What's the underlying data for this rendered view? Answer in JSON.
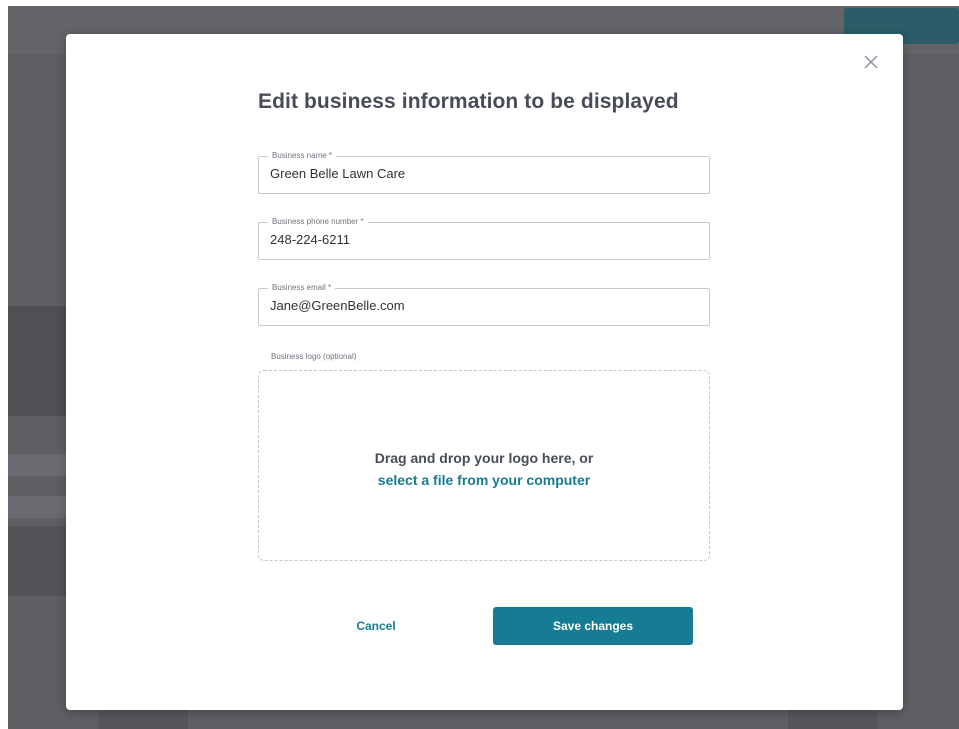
{
  "modal": {
    "title": "Edit business information to be displayed",
    "close_icon": "close-icon",
    "fields": {
      "business_name": {
        "label": "Business name *",
        "value": "Green Belle Lawn Care"
      },
      "business_phone": {
        "label": "Business phone number *",
        "value": "248-224-6211"
      },
      "business_email": {
        "label": "Business email *",
        "value": "Jane@GreenBelle.com"
      }
    },
    "logo": {
      "label": "Business logo (optional)",
      "drop_text": "Drag and drop your logo here, or",
      "select_link": "select a file from your computer"
    },
    "actions": {
      "cancel_label": "Cancel",
      "save_label": "Save changes"
    }
  },
  "colors": {
    "accent": "#167c93",
    "title_text": "#474c57",
    "backdrop": "#5e5e63"
  }
}
